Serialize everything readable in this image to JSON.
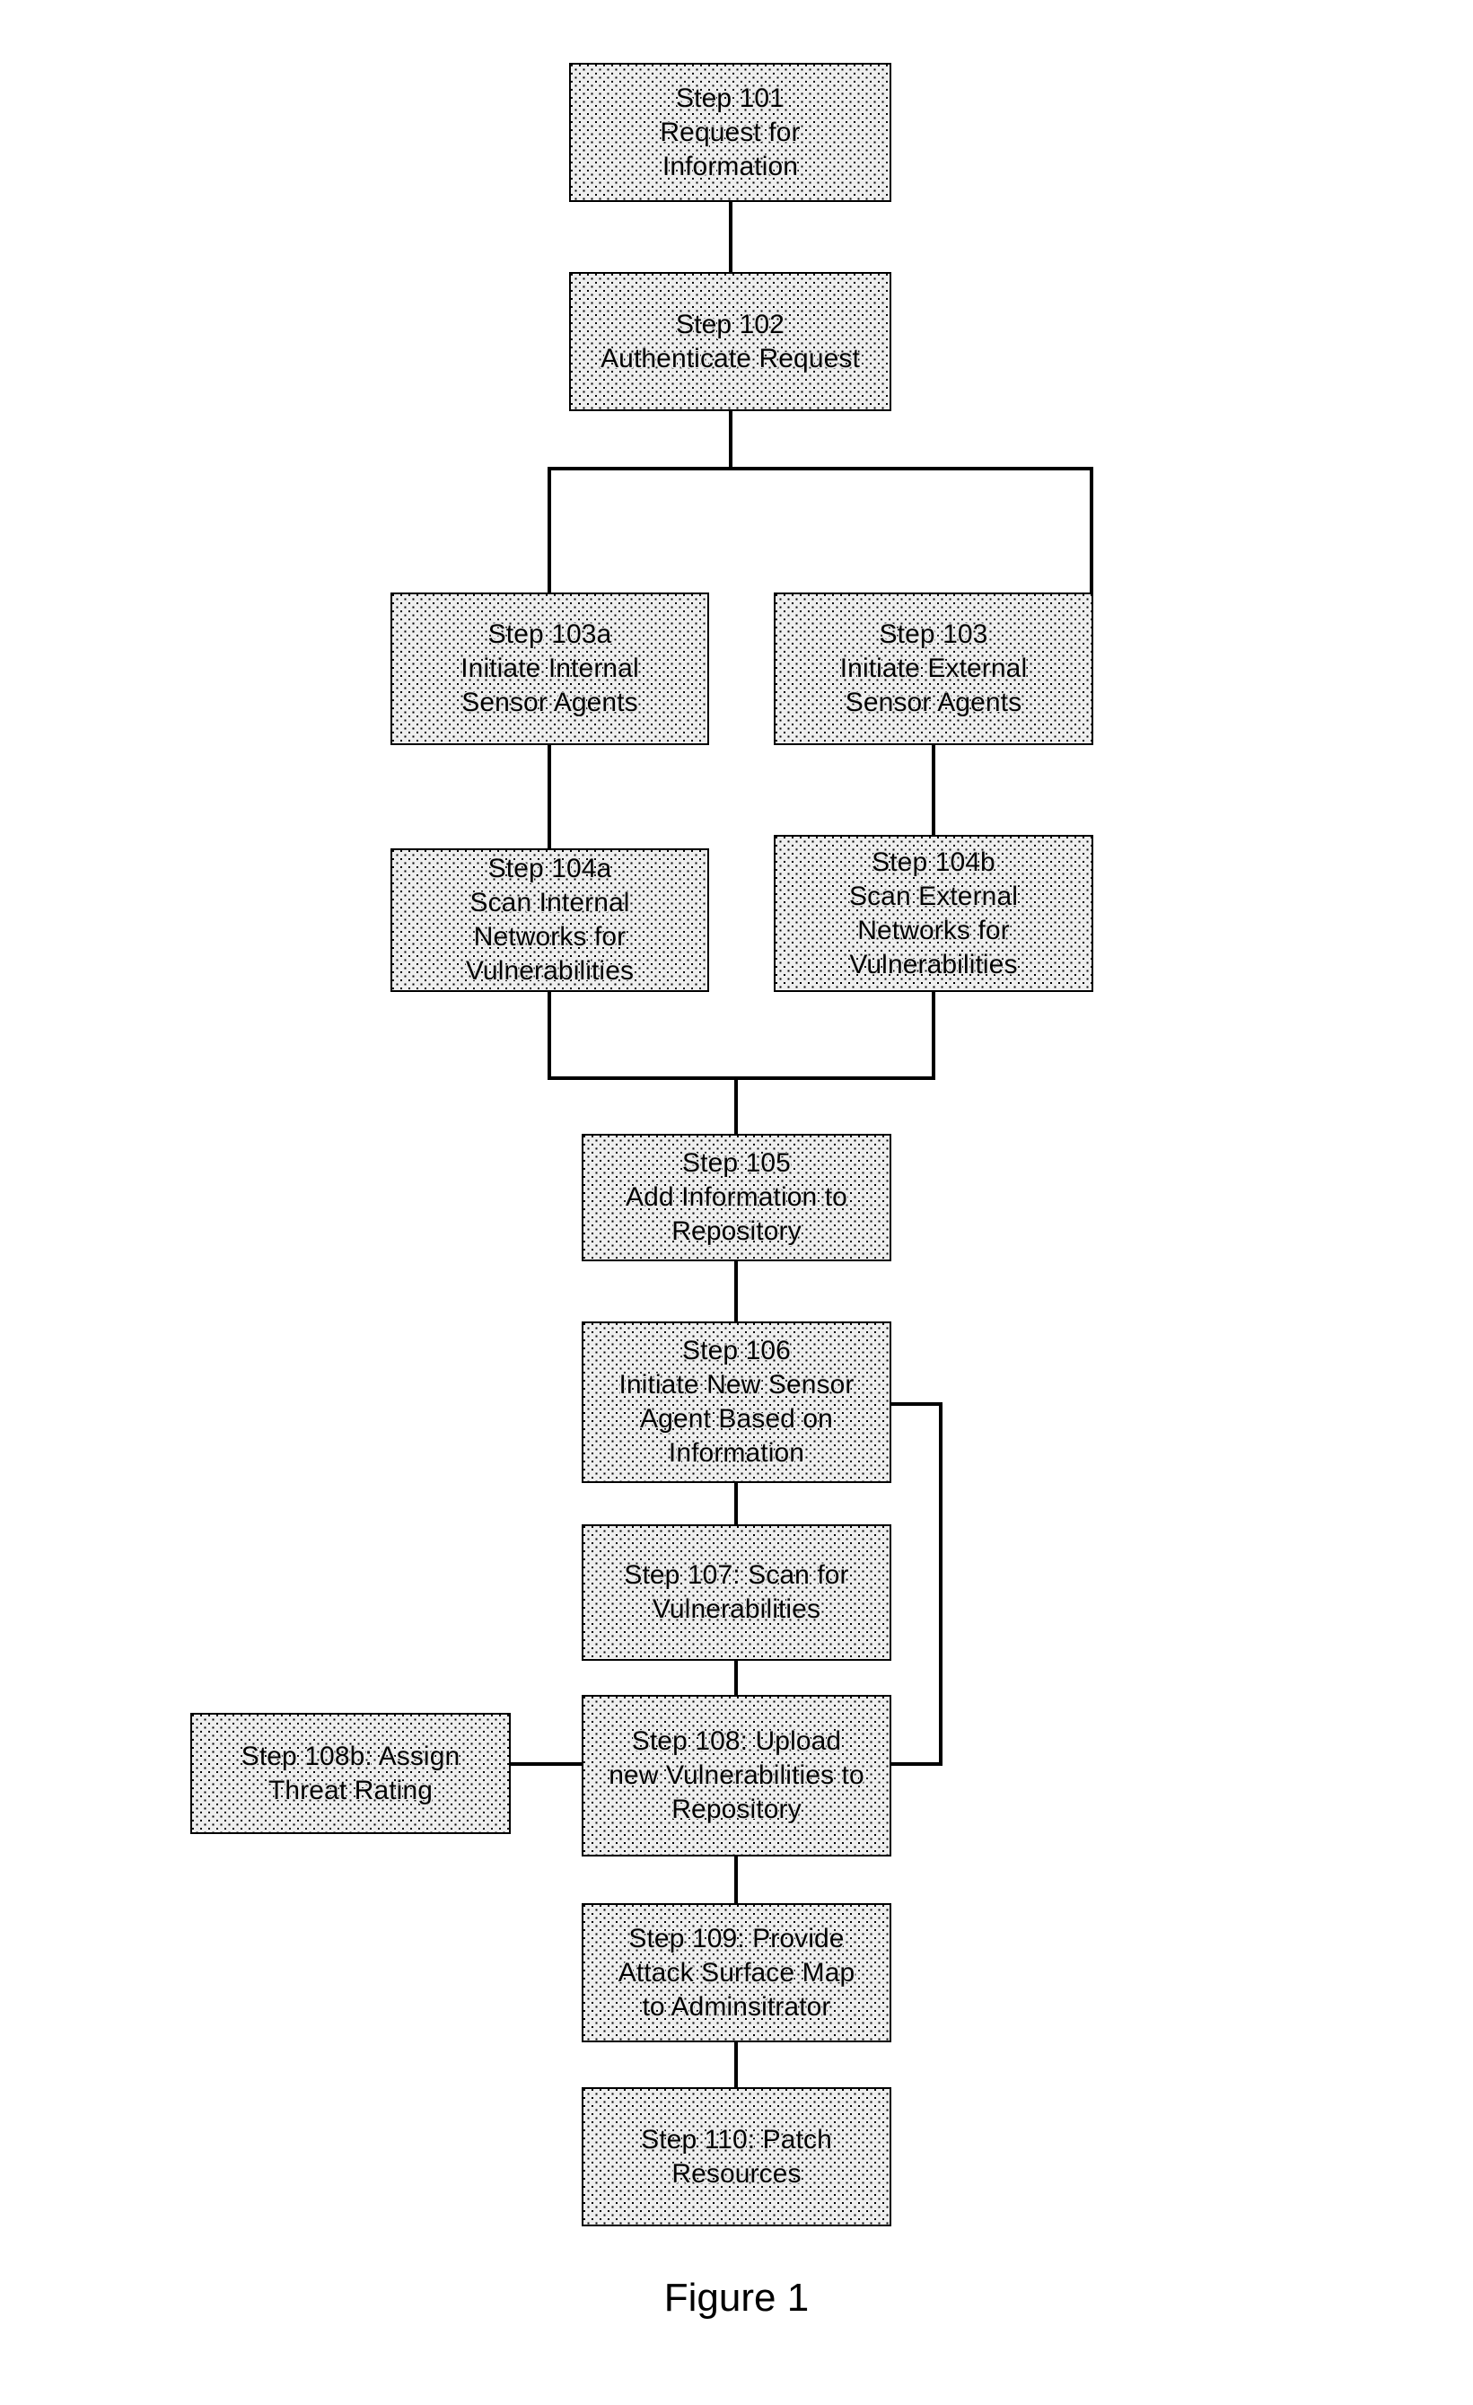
{
  "figure": {
    "caption": "Figure 1",
    "type": "process-flowchart"
  },
  "nodes": [
    {
      "id": "step-101",
      "label": "Step 101\nRequest for\nInformation"
    },
    {
      "id": "step-102",
      "label": "Step 102\nAuthenticate Request"
    },
    {
      "id": "step-103a",
      "label": "Step 103a\nInitiate Internal\nSensor Agents"
    },
    {
      "id": "step-103",
      "label": "Step 103\nInitiate External\nSensor Agents"
    },
    {
      "id": "step-104a",
      "label": "Step 104a\nScan Internal\nNetworks for\nVulnerabilities"
    },
    {
      "id": "step-104b",
      "label": "Step 104b\nScan External\nNetworks for\nVulnerabilities"
    },
    {
      "id": "step-105",
      "label": "Step 105\nAdd Information to\nRepository"
    },
    {
      "id": "step-106",
      "label": "Step 106\nInitiate New Sensor\nAgent Based on\nInformation"
    },
    {
      "id": "step-107",
      "label": "Step 107: Scan for\nVulnerabilities"
    },
    {
      "id": "step-108",
      "label": "Step 108: Upload\nnew Vulnerabilities to\nRepository"
    },
    {
      "id": "step-108b",
      "label": "Step 108b: Assign\nThreat Rating"
    },
    {
      "id": "step-109",
      "label": "Step 109: Provide\nAttack Surface Map\nto Adminsitrator"
    },
    {
      "id": "step-110",
      "label": "Step 110: Patch\nResources"
    }
  ],
  "edges": [
    {
      "from": "step-101",
      "to": "step-102"
    },
    {
      "from": "step-102",
      "to": "step-103a"
    },
    {
      "from": "step-102",
      "to": "step-103"
    },
    {
      "from": "step-103a",
      "to": "step-104a"
    },
    {
      "from": "step-103",
      "to": "step-104b"
    },
    {
      "from": "step-104a",
      "to": "step-105"
    },
    {
      "from": "step-104b",
      "to": "step-105"
    },
    {
      "from": "step-105",
      "to": "step-106"
    },
    {
      "from": "step-106",
      "to": "step-107"
    },
    {
      "from": "step-107",
      "to": "step-108"
    },
    {
      "from": "step-108b",
      "to": "step-108"
    },
    {
      "from": "step-108",
      "to": "step-106"
    },
    {
      "from": "step-108",
      "to": "step-109"
    },
    {
      "from": "step-109",
      "to": "step-110"
    }
  ],
  "style": {
    "line_color": "#000000",
    "box_fill": "#eeeeee",
    "box_border": "#000000",
    "text_color": "#000000",
    "page_background": "#ffffff"
  }
}
